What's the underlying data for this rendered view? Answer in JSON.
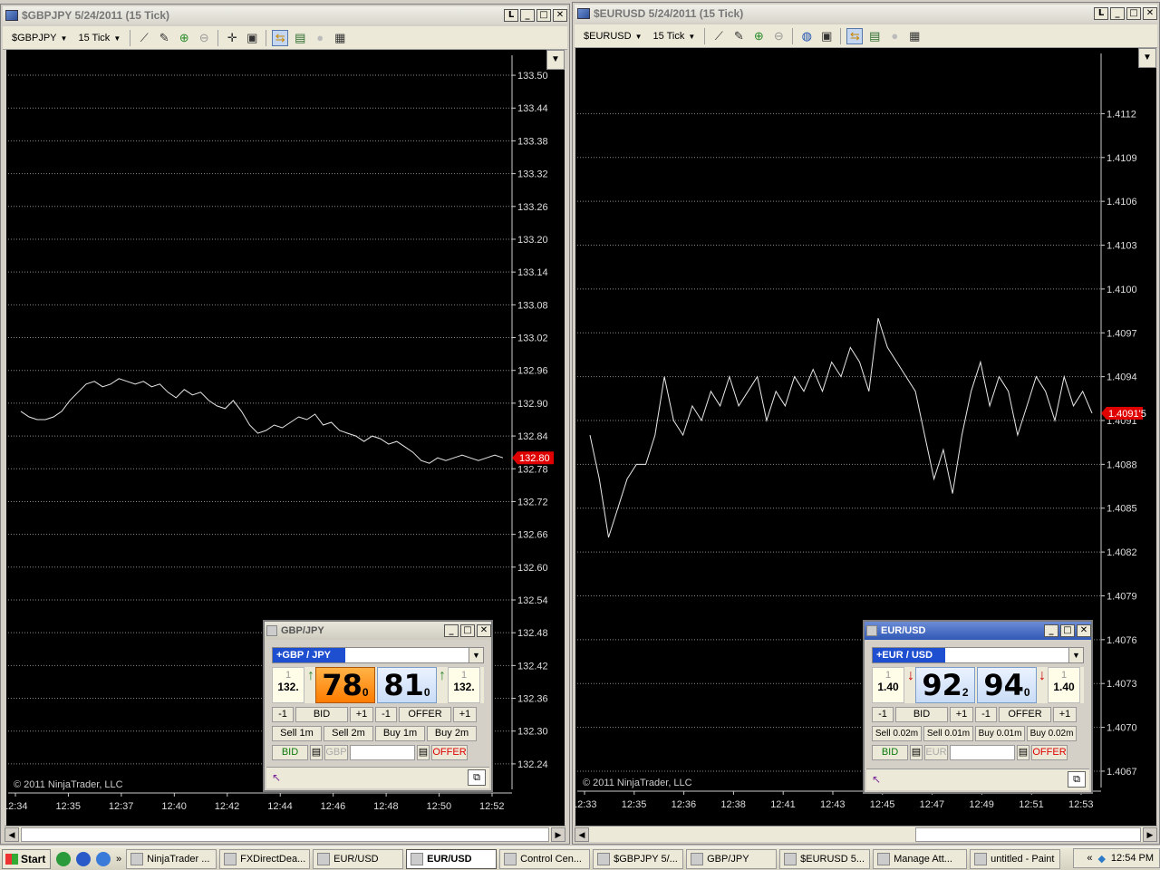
{
  "left_window": {
    "title": "$GBPJPY  5/24/2011 (15 Tick)",
    "instrument": "$GBPJPY",
    "interval": "15 Tick",
    "copyright": "© 2011 NinjaTrader, LLC",
    "current_price_label": "132.80",
    "y_ticks": [
      "133.50",
      "133.44",
      "133.38",
      "133.32",
      "133.26",
      "133.20",
      "133.14",
      "133.08",
      "133.02",
      "132.96",
      "132.90",
      "132.84",
      "132.78",
      "132.72",
      "132.66",
      "132.60",
      "132.54",
      "132.48",
      "132.42",
      "132.36",
      "132.30",
      "132.24"
    ],
    "x_ticks": [
      "12:34",
      "12:35",
      "12:37",
      "12:40",
      "12:42",
      "12:44",
      "12:46",
      "12:48",
      "12:50",
      "12:52"
    ]
  },
  "right_window": {
    "title": "$EURUSD  5/24/2011 (15 Tick)",
    "instrument": "$EURUSD",
    "interval": "15 Tick",
    "copyright": "© 2011 NinjaTrader, LLC",
    "current_price_label": "1.4091'5",
    "y_ticks": [
      "1.4112",
      "1.4109",
      "1.4106",
      "1.4103",
      "1.4100",
      "1.4097",
      "1.4094",
      "1.4091",
      "1.4088",
      "1.4085",
      "1.4082",
      "1.4079",
      "1.4076",
      "1.4073",
      "1.4070",
      "1.4067"
    ],
    "x_ticks": [
      "12:33",
      "12:35",
      "12:36",
      "12:38",
      "12:41",
      "12:43",
      "12:45",
      "12:47",
      "12:49",
      "12:51",
      "12:53"
    ]
  },
  "gbp_panel": {
    "title": "GBP/JPY",
    "pair": "+GBP / JPY",
    "bid_lot": "1",
    "bid_big": "132.",
    "bid_main": "78",
    "bid_pip": "0",
    "offer_main": "81",
    "offer_pip": "0",
    "offer_lot": "1",
    "offer_big": "132.",
    "bid_arrow": "↑",
    "offer_arrow": "↑",
    "row1": [
      "-1",
      "BID",
      "+1",
      "-1",
      "OFFER",
      "+1"
    ],
    "row2": [
      "Sell 1m",
      "Sell 2m",
      "Buy 1m",
      "Buy 2m"
    ],
    "bid_btn": "BID",
    "ccy_btn": "GBP",
    "offer_btn": "OFFER"
  },
  "eur_panel": {
    "title": "EUR/USD",
    "pair": "+EUR / USD",
    "bid_lot": "1",
    "bid_big": "1.40",
    "bid_main": "92",
    "bid_pip": "2",
    "offer_main": "94",
    "offer_pip": "0",
    "offer_lot": "1",
    "offer_big": "1.40",
    "bid_arrow": "↓",
    "offer_arrow": "↓",
    "row1": [
      "-1",
      "BID",
      "+1",
      "-1",
      "OFFER",
      "+1"
    ],
    "row2": [
      "Sell 0.02m",
      "Sell 0.01m",
      "Buy 0.01m",
      "Buy 0.02m"
    ],
    "bid_btn": "BID",
    "ccy_btn": "EUR",
    "offer_btn": "OFFER"
  },
  "taskbar": {
    "start": "Start",
    "items": [
      "NinjaTrader ...",
      "FXDirectDea...",
      "EUR/USD",
      "EUR/USD",
      "Control Cen...",
      "$GBPJPY  5/...",
      "GBP/JPY",
      "$EURUSD  5...",
      "Manage Att...",
      "untitled - Paint"
    ],
    "clock": "12:54 PM"
  },
  "chart_data": [
    {
      "type": "line",
      "instrument": "$GBPJPY",
      "ylim": [
        132.21,
        133.52
      ],
      "y": [
        132.885,
        132.875,
        132.87,
        132.87,
        132.875,
        132.885,
        132.905,
        132.92,
        132.935,
        132.94,
        132.93,
        132.935,
        132.945,
        132.94,
        132.935,
        132.94,
        132.93,
        132.935,
        132.92,
        132.91,
        132.925,
        132.915,
        132.92,
        132.905,
        132.895,
        132.89,
        132.905,
        132.885,
        132.86,
        132.845,
        132.85,
        132.86,
        132.855,
        132.865,
        132.875,
        132.87,
        132.88,
        132.86,
        132.865,
        132.85,
        132.845,
        132.84,
        132.83,
        132.84,
        132.835,
        132.825,
        132.83,
        132.82,
        132.81,
        132.795,
        132.79,
        132.8,
        132.795,
        132.8,
        132.805,
        132.8,
        132.795,
        132.8,
        132.805,
        132.8
      ]
    },
    {
      "type": "line",
      "instrument": "$EURUSD",
      "ylim": [
        1.40665,
        1.41155
      ],
      "y": [
        1.409,
        1.4087,
        1.4083,
        1.4085,
        1.4087,
        1.4088,
        1.4088,
        1.409,
        1.4094,
        1.4091,
        1.409,
        1.4092,
        1.4091,
        1.4093,
        1.4092,
        1.4094,
        1.4092,
        1.4093,
        1.4094,
        1.4091,
        1.4093,
        1.4092,
        1.4094,
        1.4093,
        1.40945,
        1.4093,
        1.4095,
        1.4094,
        1.4096,
        1.4095,
        1.4093,
        1.4098,
        1.4096,
        1.4095,
        1.4094,
        1.4093,
        1.409,
        1.4087,
        1.4089,
        1.4086,
        1.409,
        1.4093,
        1.4095,
        1.4092,
        1.4094,
        1.4093,
        1.409,
        1.4092,
        1.4094,
        1.4093,
        1.4091,
        1.4094,
        1.4092,
        1.4093,
        1.40915
      ]
    }
  ]
}
